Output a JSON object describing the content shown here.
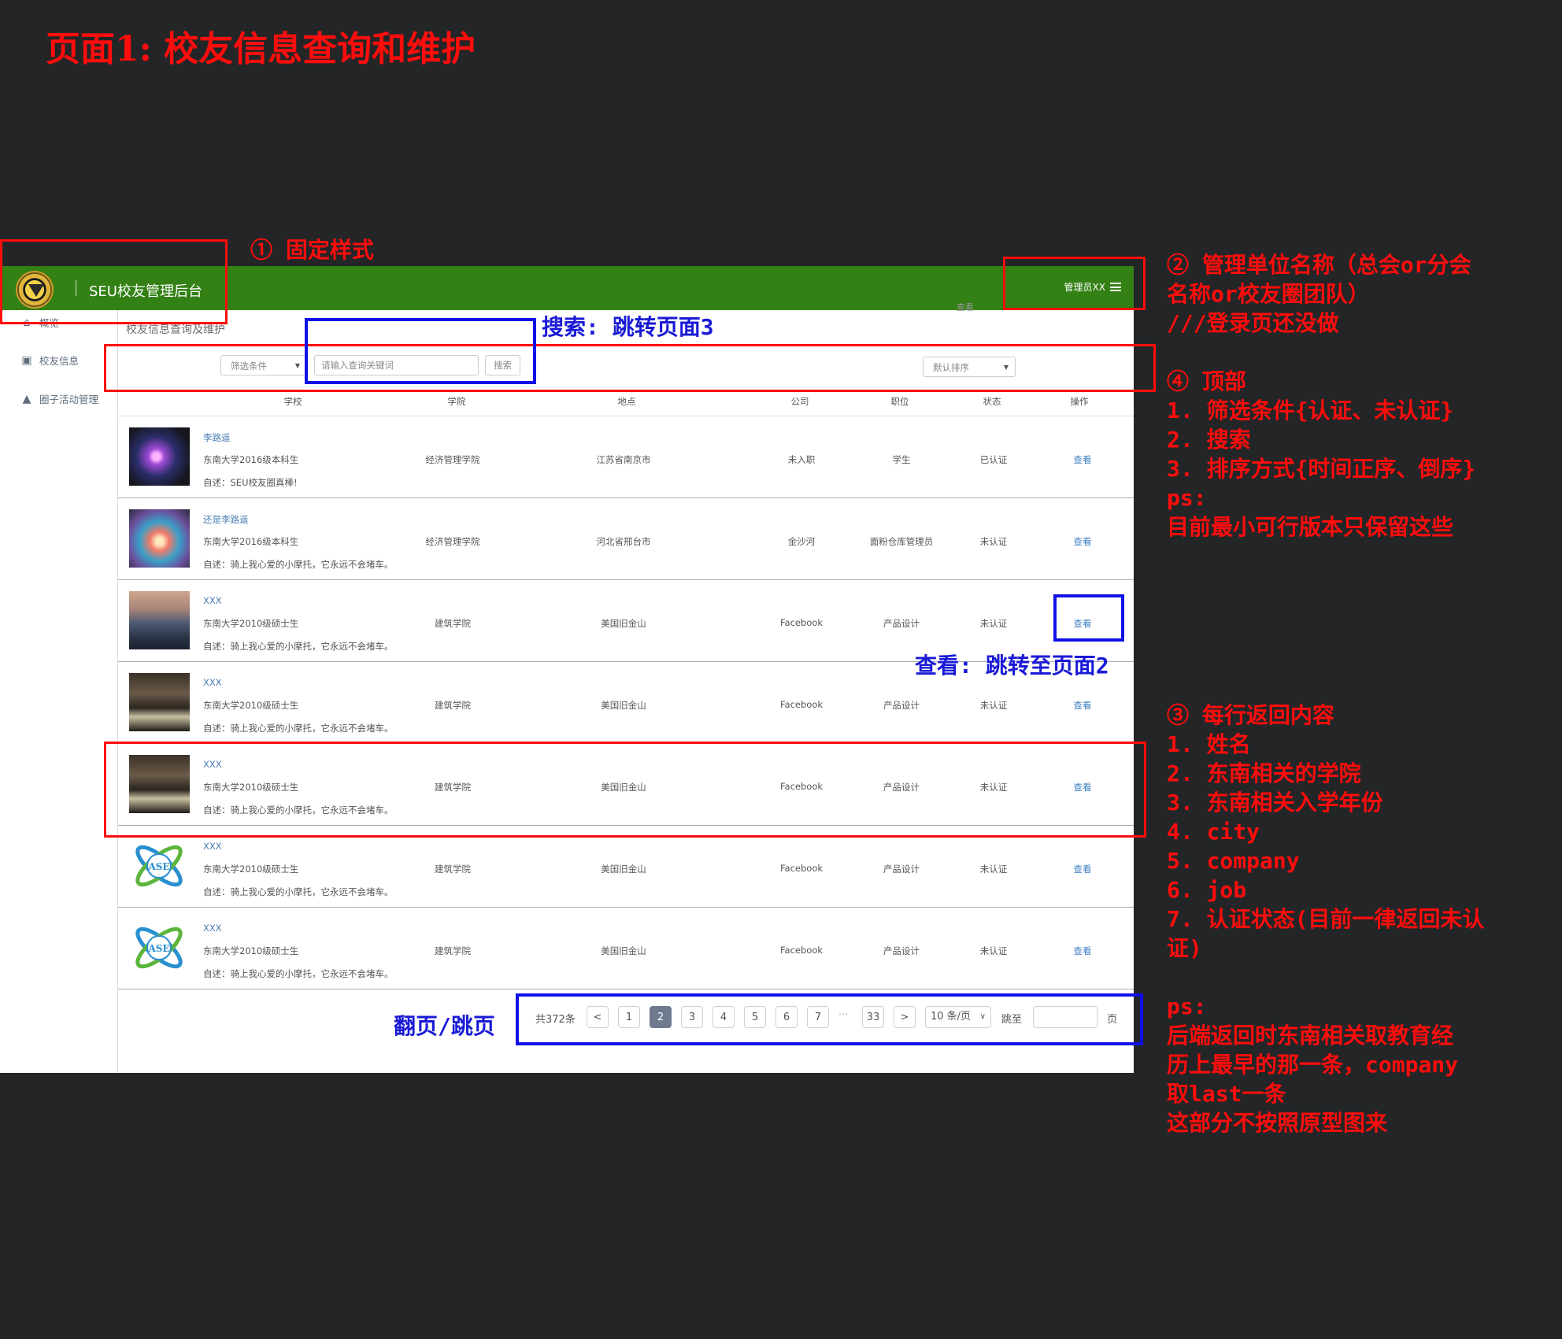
{
  "page_title": "页面1: 校友信息查询和维护",
  "app": {
    "title": "SEU校友管理后台",
    "admin_label": "管理员XX",
    "breadcrumb": "校友信息查询及维护",
    "breadcrumb_right": "查看"
  },
  "sidebar": {
    "items": [
      {
        "label": "概览",
        "icon": "home-icon"
      },
      {
        "label": "校友信息",
        "icon": "briefcase-icon"
      },
      {
        "label": "圈子活动管理",
        "icon": "cart-icon"
      }
    ]
  },
  "toolbar": {
    "filter_value": "筛选条件",
    "search_placeholder": "请输入查询关键词",
    "search_label": "搜索",
    "sort_value": "默认排序"
  },
  "table": {
    "columns": [
      "学校",
      "学院",
      "地点",
      "公司",
      "职位",
      "状态",
      "操作"
    ],
    "rows": [
      {
        "name": "李路遥",
        "edu": "东南大学2016级本科生",
        "bio": "自述：SEU校友圈真棒!",
        "college": "经济管理学院",
        "city": "江苏省南京市",
        "company": "未入职",
        "job": "学生",
        "status": "已认证",
        "action": "查看",
        "thumb": "purple-burst"
      },
      {
        "name": "还是李路遥",
        "edu": "东南大学2016级本科生",
        "bio": "自述：骑上我心爱的小摩托，它永远不会堵车。",
        "college": "经济管理学院",
        "city": "河北省邢台市",
        "company": "金沙河",
        "job": "面粉仓库管理员",
        "status": "未认证",
        "action": "查看",
        "thumb": "color-burst"
      },
      {
        "name": "XXX",
        "edu": "东南大学2010级硕士生",
        "bio": "自述：骑上我心爱的小摩托，它永远不会堵车。",
        "college": "建筑学院",
        "city": "美国旧金山",
        "company": "Facebook",
        "job": "产品设计",
        "status": "未认证",
        "action": "查看",
        "thumb": "mountain"
      },
      {
        "name": "XXX",
        "edu": "东南大学2010级硕士生",
        "bio": "自述：骑上我心爱的小摩托，它永远不会堵车。",
        "college": "建筑学院",
        "city": "美国旧金山",
        "company": "Facebook",
        "job": "产品设计",
        "status": "未认证",
        "action": "查看",
        "thumb": "night-building"
      },
      {
        "name": "XXX",
        "edu": "东南大学2010级硕士生",
        "bio": "自述：骑上我心爱的小摩托，它永远不会堵车。",
        "college": "建筑学院",
        "city": "美国旧金山",
        "company": "Facebook",
        "job": "产品设计",
        "status": "未认证",
        "action": "查看",
        "thumb": "night-building"
      },
      {
        "name": "XXX",
        "edu": "东南大学2010级硕士生",
        "bio": "自述：骑上我心爱的小摩托，它永远不会堵车。",
        "college": "建筑学院",
        "city": "美国旧金山",
        "company": "Facebook",
        "job": "产品设计",
        "status": "未认证",
        "action": "查看",
        "thumb": "ase-logo"
      },
      {
        "name": "XXX",
        "edu": "东南大学2010级硕士生",
        "bio": "自述：骑上我心爱的小摩托，它永远不会堵车。",
        "college": "建筑学院",
        "city": "美国旧金山",
        "company": "Facebook",
        "job": "产品设计",
        "status": "未认证",
        "action": "查看",
        "thumb": "ase-logo"
      }
    ]
  },
  "ase_logo_text": "ASE",
  "pagination": {
    "total": "共372条",
    "prev": "<",
    "pages": [
      "1",
      "2",
      "3",
      "4",
      "5",
      "6",
      "7"
    ],
    "active_page": "2",
    "ellipsis": "···",
    "last_page": "33",
    "next": ">",
    "page_size": "10 条/页",
    "jump_label": "跳至",
    "page_suffix": "页"
  },
  "annotations": {
    "fixed_style": "① 固定样式",
    "search_note": "搜索: 跳转页面3",
    "view_note": "查看: 跳转至页面2",
    "paging_note": "翻页/跳页",
    "mgmt_lines": [
      "② 管理单位名称（总会or分会",
      "名称or校友圈团队）",
      "///登录页还没做"
    ],
    "top_lines": [
      "④ 顶部",
      "1. 筛选条件{认证、未认证}",
      "2. 搜索",
      "3. 排序方式{时间正序、倒序}",
      "ps:",
      "目前最小可行版本只保留这些"
    ],
    "row_lines": [
      "③ 每行返回内容",
      "1. 姓名",
      "2. 东南相关的学院",
      "3. 东南相关入学年份",
      "4. city",
      "5. company",
      "6. job",
      "7. 认证状态(目前一律返回未认",
      "证)",
      "",
      "ps:",
      "后端返回时东南相关取教育经",
      "历上最早的那一条，company",
      "取last一条",
      "这部分不按照原型图来"
    ]
  },
  "colors": {
    "header_green": "#338015",
    "annotation_red": "#ff0d0d",
    "annotation_blue": "#1010e8",
    "link_blue": "#3d7fc1",
    "page_active": "#6f7a8f"
  }
}
